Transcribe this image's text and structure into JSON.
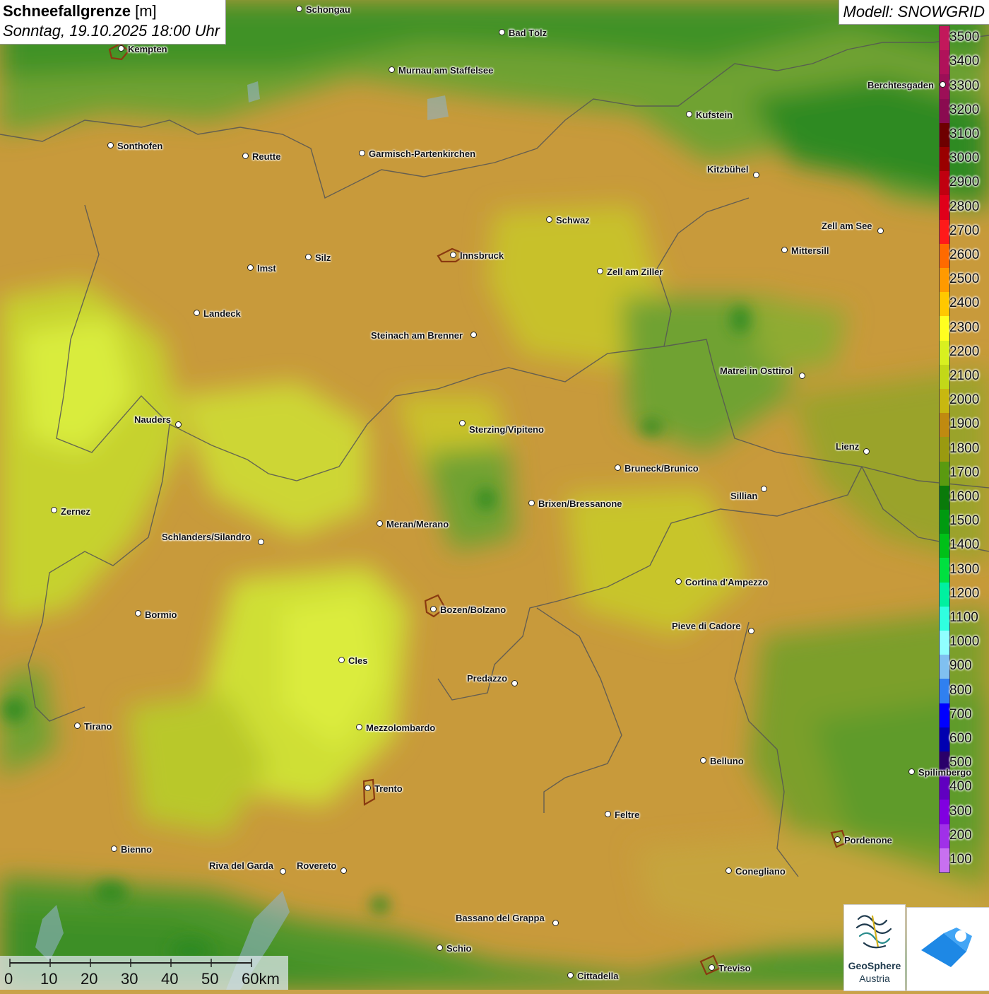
{
  "header": {
    "title_bold": "Schneefallgrenze",
    "title_unit": "[m]",
    "subtitle": "Sonntag, 19.10.2025 18:00 Uhr"
  },
  "model": {
    "label": "Modell: SNOWGRID"
  },
  "legend": {
    "entries": [
      {
        "label": "3500",
        "color": "#c2185b"
      },
      {
        "label": "3400",
        "color": "#b0125a"
      },
      {
        "label": "3300",
        "color": "#9c0f57"
      },
      {
        "label": "3200",
        "color": "#8a0b50"
      },
      {
        "label": "3100",
        "color": "#6e0000"
      },
      {
        "label": "3000",
        "color": "#9a0000"
      },
      {
        "label": "2900",
        "color": "#c00010"
      },
      {
        "label": "2800",
        "color": "#e0001a"
      },
      {
        "label": "2700",
        "color": "#ff1a1a"
      },
      {
        "label": "2600",
        "color": "#ff6a00"
      },
      {
        "label": "2500",
        "color": "#ff9a00"
      },
      {
        "label": "2400",
        "color": "#ffc800"
      },
      {
        "label": "2300",
        "color": "#ffff20"
      },
      {
        "label": "2200",
        "color": "#d8f020"
      },
      {
        "label": "2100",
        "color": "#c2d818"
      },
      {
        "label": "2000",
        "color": "#c8b810"
      },
      {
        "label": "1900",
        "color": "#c08a10"
      },
      {
        "label": "1800",
        "color": "#9a9a10"
      },
      {
        "label": "1700",
        "color": "#5a9a10"
      },
      {
        "label": "1600",
        "color": "#0a7a0a"
      },
      {
        "label": "1500",
        "color": "#009a10"
      },
      {
        "label": "1400",
        "color": "#00c018"
      },
      {
        "label": "1300",
        "color": "#00e040"
      },
      {
        "label": "1200",
        "color": "#00f0a0"
      },
      {
        "label": "1100",
        "color": "#30ffe0"
      },
      {
        "label": "1000",
        "color": "#90ffff"
      },
      {
        "label": "900",
        "color": "#80c0f0"
      },
      {
        "label": "800",
        "color": "#3080f0"
      },
      {
        "label": "700",
        "color": "#0000ff"
      },
      {
        "label": "600",
        "color": "#0000b0"
      },
      {
        "label": "500",
        "color": "#2a006a"
      },
      {
        "label": "400",
        "color": "#6000c0"
      },
      {
        "label": "300",
        "color": "#8000e0"
      },
      {
        "label": "200",
        "color": "#a030e8"
      },
      {
        "label": "100",
        "color": "#c870f0"
      }
    ]
  },
  "cities": [
    {
      "name": "Schongau",
      "dot": [
        424,
        13
      ],
      "lbl": [
        433,
        6
      ]
    },
    {
      "name": "Bad Tölz",
      "dot": [
        711,
        46
      ],
      "lbl": [
        720,
        39
      ]
    },
    {
      "name": "Kempten",
      "dot": [
        172,
        69
      ],
      "lbl": [
        181,
        62
      ]
    },
    {
      "name": "Murnau am Staffelsee",
      "dot": [
        555,
        99
      ],
      "lbl": [
        564,
        92
      ]
    },
    {
      "name": "Berchtesgaden",
      "dot": [
        1335,
        120
      ],
      "lbl": [
        1228,
        113
      ]
    },
    {
      "name": "Kufstein",
      "dot": [
        976,
        162
      ],
      "lbl": [
        985,
        155
      ]
    },
    {
      "name": "Sonthofen",
      "dot": [
        157,
        206
      ],
      "lbl": [
        166,
        199
      ]
    },
    {
      "name": "Reutte",
      "dot": [
        348,
        221
      ],
      "lbl": [
        357,
        214
      ]
    },
    {
      "name": "Garmisch-Partenkirchen",
      "dot": [
        513,
        217
      ],
      "lbl": [
        522,
        210
      ]
    },
    {
      "name": "Kitzbühel",
      "dot": [
        1071,
        248
      ],
      "lbl": [
        1001,
        232
      ]
    },
    {
      "name": "Schwaz",
      "dot": [
        778,
        311
      ],
      "lbl": [
        787,
        304
      ]
    },
    {
      "name": "Zell am See",
      "dot": [
        1247,
        327
      ],
      "lbl": [
        1163,
        312
      ]
    },
    {
      "name": "Mittersill",
      "dot": [
        1111,
        354
      ],
      "lbl": [
        1120,
        347
      ]
    },
    {
      "name": "Innsbruck",
      "dot": [
        642,
        361
      ],
      "lbl": [
        651,
        354
      ]
    },
    {
      "name": "Silz",
      "dot": [
        437,
        364
      ],
      "lbl": [
        446,
        357
      ]
    },
    {
      "name": "Imst",
      "dot": [
        355,
        379
      ],
      "lbl": [
        364,
        372
      ]
    },
    {
      "name": "Zell am Ziller",
      "dot": [
        850,
        384
      ],
      "lbl": [
        859,
        377
      ]
    },
    {
      "name": "Landeck",
      "dot": [
        279,
        443
      ],
      "lbl": [
        288,
        436
      ]
    },
    {
      "name": "Steinach am Brenner",
      "dot": [
        671,
        474
      ],
      "lbl": [
        525,
        467
      ]
    },
    {
      "name": "Matrei in Osttirol",
      "dot": [
        1136,
        532
      ],
      "lbl": [
        1019,
        517
      ]
    },
    {
      "name": "Nauders",
      "dot": [
        253,
        601
      ],
      "lbl": [
        190,
        586
      ]
    },
    {
      "name": "Sterzing/Vipiteno",
      "dot": [
        655,
        599
      ],
      "lbl": [
        664,
        600
      ]
    },
    {
      "name": "Lienz",
      "dot": [
        1227,
        639
      ],
      "lbl": [
        1183,
        624
      ]
    },
    {
      "name": "Bruneck/Brunico",
      "dot": [
        875,
        662
      ],
      "lbl": [
        884,
        655
      ]
    },
    {
      "name": "Sillian",
      "dot": [
        1082,
        692
      ],
      "lbl": [
        1034,
        694
      ]
    },
    {
      "name": "Brixen/Bressanone",
      "dot": [
        753,
        712
      ],
      "lbl": [
        762,
        705
      ]
    },
    {
      "name": "Zernez",
      "dot": [
        77,
        722
      ],
      "lbl": [
        86,
        716
      ]
    },
    {
      "name": "Meran/Merano",
      "dot": [
        538,
        741
      ],
      "lbl": [
        547,
        734
      ]
    },
    {
      "name": "Schlanders/Silandro",
      "dot": [
        370,
        767
      ],
      "lbl": [
        229,
        752
      ]
    },
    {
      "name": "Cortina d'Ampezzo",
      "dot": [
        961,
        823
      ],
      "lbl": [
        970,
        816
      ]
    },
    {
      "name": "Bozen/Bolzano",
      "dot": [
        614,
        862
      ],
      "lbl": [
        623,
        855
      ]
    },
    {
      "name": "Bormio",
      "dot": [
        196,
        868
      ],
      "lbl": [
        205,
        862
      ]
    },
    {
      "name": "Pieve di Cadore",
      "dot": [
        1064,
        893
      ],
      "lbl": [
        951,
        878
      ]
    },
    {
      "name": "Cles",
      "dot": [
        484,
        934
      ],
      "lbl": [
        493,
        927
      ]
    },
    {
      "name": "Predazzo",
      "dot": [
        729,
        967
      ],
      "lbl": [
        661,
        952
      ]
    },
    {
      "name": "Tirano",
      "dot": [
        110,
        1027
      ],
      "lbl": [
        119,
        1020
      ]
    },
    {
      "name": "Mezzolombardo",
      "dot": [
        509,
        1029
      ],
      "lbl": [
        518,
        1022
      ]
    },
    {
      "name": "Belluno",
      "dot": [
        996,
        1076
      ],
      "lbl": [
        1005,
        1069
      ]
    },
    {
      "name": "Spilimbergo",
      "dot": [
        1291,
        1092
      ],
      "lbl": [
        1300,
        1085
      ]
    },
    {
      "name": "Trento",
      "dot": [
        521,
        1115
      ],
      "lbl": [
        530,
        1108
      ]
    },
    {
      "name": "Feltre",
      "dot": [
        861,
        1152
      ],
      "lbl": [
        870,
        1145
      ]
    },
    {
      "name": "Pordenone",
      "dot": [
        1186,
        1188
      ],
      "lbl": [
        1195,
        1181
      ]
    },
    {
      "name": "Bienno",
      "dot": [
        162,
        1201
      ],
      "lbl": [
        171,
        1194
      ]
    },
    {
      "name": "Riva del Garda",
      "dot": [
        401,
        1233
      ],
      "lbl": [
        296,
        1217
      ]
    },
    {
      "name": "Rovereto",
      "dot": [
        487,
        1232
      ],
      "lbl": [
        420,
        1217
      ]
    },
    {
      "name": "Conegliano",
      "dot": [
        1032,
        1232
      ],
      "lbl": [
        1041,
        1225
      ]
    },
    {
      "name": "Bassano del Grappa",
      "dot": [
        787,
        1306
      ],
      "lbl": [
        645,
        1291
      ]
    },
    {
      "name": "Schio",
      "dot": [
        623,
        1341
      ],
      "lbl": [
        632,
        1334
      ]
    },
    {
      "name": "Treviso",
      "dot": [
        1008,
        1369
      ],
      "lbl": [
        1017,
        1362
      ]
    },
    {
      "name": "Cittadella",
      "dot": [
        808,
        1380
      ],
      "lbl": [
        817,
        1373
      ]
    }
  ],
  "scale": {
    "labels": [
      "0",
      "10",
      "20",
      "30",
      "40",
      "50",
      "60km"
    ]
  },
  "logos": {
    "geosphere_line1": "GeoSphere",
    "geosphere_line2": "Austria"
  },
  "colors": {
    "orange_high": "#c9993a",
    "yellow_mid": "#c7c52a",
    "lime_high": "#d3e43a",
    "green_low": "#5f9b2a",
    "green_lower": "#3e8f26",
    "border": "#555555"
  }
}
